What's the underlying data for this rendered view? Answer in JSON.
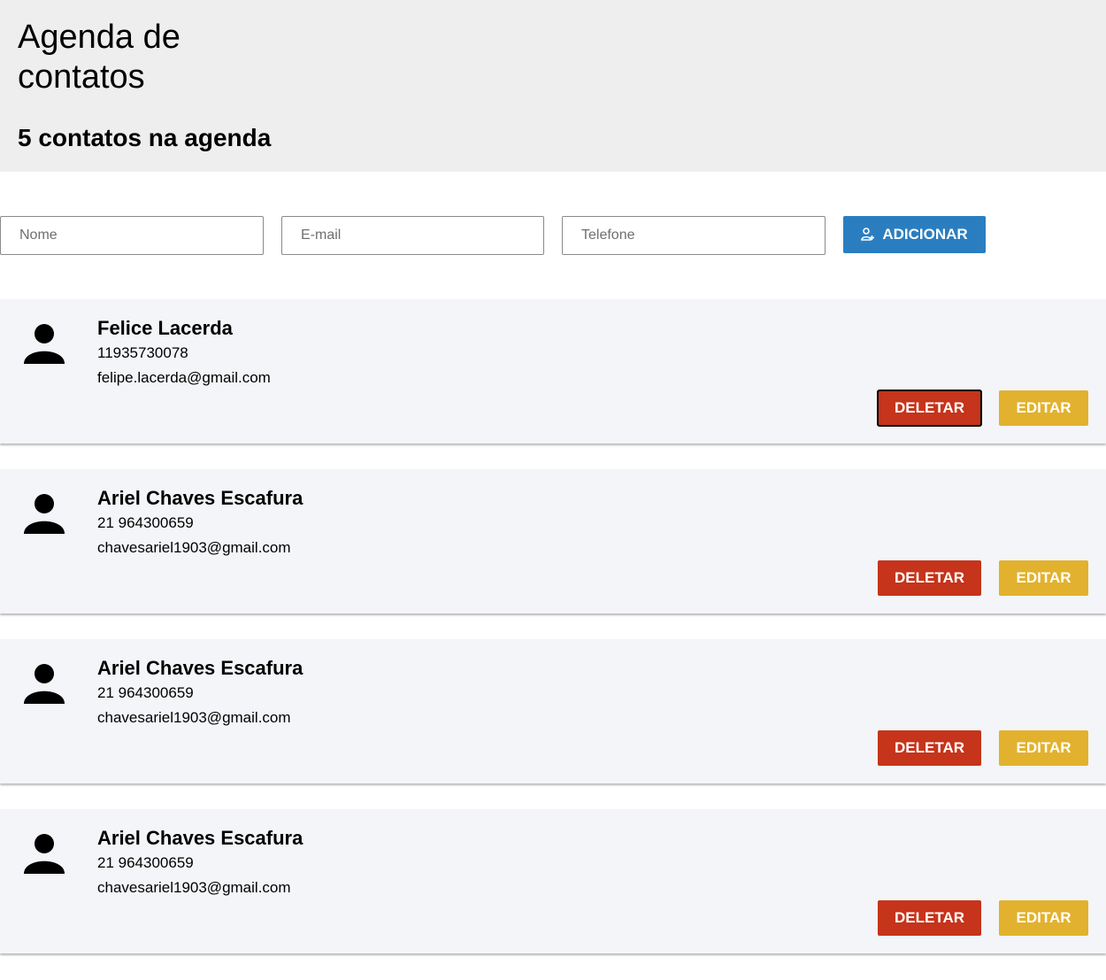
{
  "header": {
    "title": "Agenda de contatos",
    "count_text": "5 contatos na agenda"
  },
  "form": {
    "name_placeholder": "Nome",
    "email_placeholder": "E-mail",
    "phone_placeholder": "Telefone",
    "add_label": "ADICIONAR",
    "add_icon": "add-user-icon"
  },
  "colors": {
    "header_bg": "#eeeeee",
    "add_button": "#2a7ec0",
    "delete_button": "#c5341b",
    "edit_button": "#e2b12e",
    "card_bg": "#f4f5f8"
  },
  "contacts": [
    {
      "name": "Felice Lacerda",
      "phone": "11935730078",
      "email": "felipe.lacerda@gmail.com",
      "delete_label": "DELETAR",
      "edit_label": "EDITAR",
      "icon": "person-icon"
    },
    {
      "name": "Ariel Chaves Escafura",
      "phone": "21 964300659",
      "email": "chavesariel1903@gmail.com",
      "delete_label": "DELETAR",
      "edit_label": "EDITAR",
      "icon": "person-icon"
    },
    {
      "name": "Ariel Chaves Escafura",
      "phone": "21 964300659",
      "email": "chavesariel1903@gmail.com",
      "delete_label": "DELETAR",
      "edit_label": "EDITAR",
      "icon": "person-icon"
    },
    {
      "name": "Ariel Chaves Escafura",
      "phone": "21 964300659",
      "email": "chavesariel1903@gmail.com",
      "delete_label": "DELETAR",
      "edit_label": "EDITAR",
      "icon": "person-icon"
    }
  ]
}
